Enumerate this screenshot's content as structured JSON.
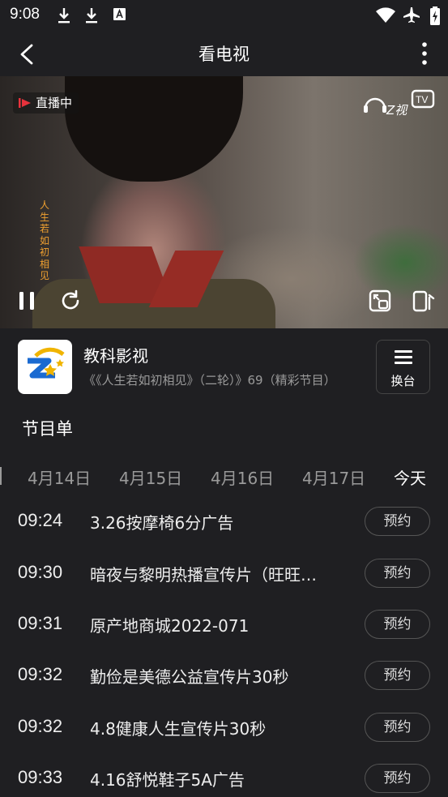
{
  "status": {
    "time": "9:08",
    "icons": [
      "download-icon",
      "download-icon",
      "font-icon",
      "wifi-icon",
      "airplane-icon",
      "battery-icon"
    ]
  },
  "appbar": {
    "title": "看电视"
  },
  "player": {
    "live_label": "直播中",
    "watermark": "人生若如初相见",
    "brand": "Z视"
  },
  "channel": {
    "name": "教科影视",
    "program": "《《人生若如初相见》（二轮）》69（精彩节目）",
    "switch_label": "换台"
  },
  "schedule": {
    "title": "节目单",
    "dates": [
      "4月14日",
      "4月15日",
      "4月16日",
      "4月17日",
      "今天"
    ],
    "active_date": "今天",
    "button_label": "预约",
    "items": [
      {
        "time": "09:24",
        "title": "3.26按摩椅6分广告"
      },
      {
        "time": "09:30",
        "title": "暗夜与黎明热播宣传片（旺旺版）"
      },
      {
        "time": "09:31",
        "title": "原产地商城2022-071"
      },
      {
        "time": "09:32",
        "title": "勤俭是美德公益宣传片30秒"
      },
      {
        "time": "09:32",
        "title": "4.8健康人生宣传片30秒"
      },
      {
        "time": "09:33",
        "title": "4.16舒悦鞋子5A广告"
      }
    ]
  },
  "colors": {
    "background": "#1f1f22",
    "text": "#eaeaea",
    "muted": "#9a9a9a",
    "live_mark": "#e8323c",
    "watermark": "#f0a030"
  }
}
